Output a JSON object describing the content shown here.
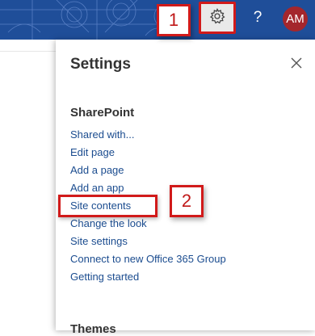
{
  "suite_bar": {
    "help_label": "?",
    "avatar_initials": "AM",
    "colors": {
      "bar": "#1f4e99",
      "avatar": "#a4262c",
      "callout": "#d11a1a"
    }
  },
  "callouts": {
    "one": "1",
    "two": "2"
  },
  "panel": {
    "title": "Settings",
    "section_title": "SharePoint",
    "menu_items": [
      "Shared with...",
      "Edit page",
      "Add a page",
      "Add an app",
      "Site contents",
      "Change the look",
      "Site settings",
      "Connect to new Office 365 Group",
      "Getting started"
    ],
    "highlighted_item": "Site contents",
    "next_section_title": "Themes"
  },
  "icons": [
    "gear-icon",
    "help-icon",
    "close-icon"
  ]
}
